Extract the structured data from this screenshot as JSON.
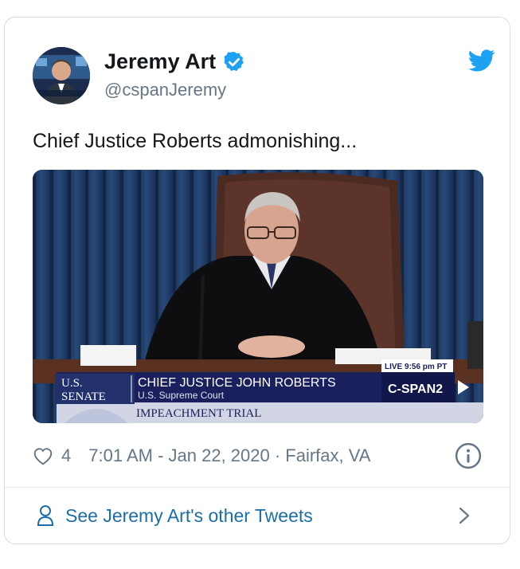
{
  "author": {
    "name": "Jeremy Art",
    "handle": "@cspanJeremy"
  },
  "tweet": {
    "text": "Chief Justice Roberts admonishing..."
  },
  "media": {
    "chyron_live": "LIVE 9:56 pm PT",
    "chyron_org_line1": "U.S.",
    "chyron_org_line2": "SENATE",
    "chyron_name": "CHIEF JUSTICE JOHN ROBERTS",
    "chyron_title": "U.S. Supreme Court",
    "chyron_event": "IMPEACHMENT TRIAL",
    "chyron_network": "C-SPAN2"
  },
  "meta": {
    "likes": "4",
    "timestamp": "7:01 AM - Jan 22, 2020 · Fairfax, VA"
  },
  "footer": {
    "label": "See Jeremy Art's other Tweets"
  },
  "colors": {
    "twitter_blue": "#1da1f2",
    "link_blue": "#1b6ea8",
    "muted": "#657786"
  }
}
